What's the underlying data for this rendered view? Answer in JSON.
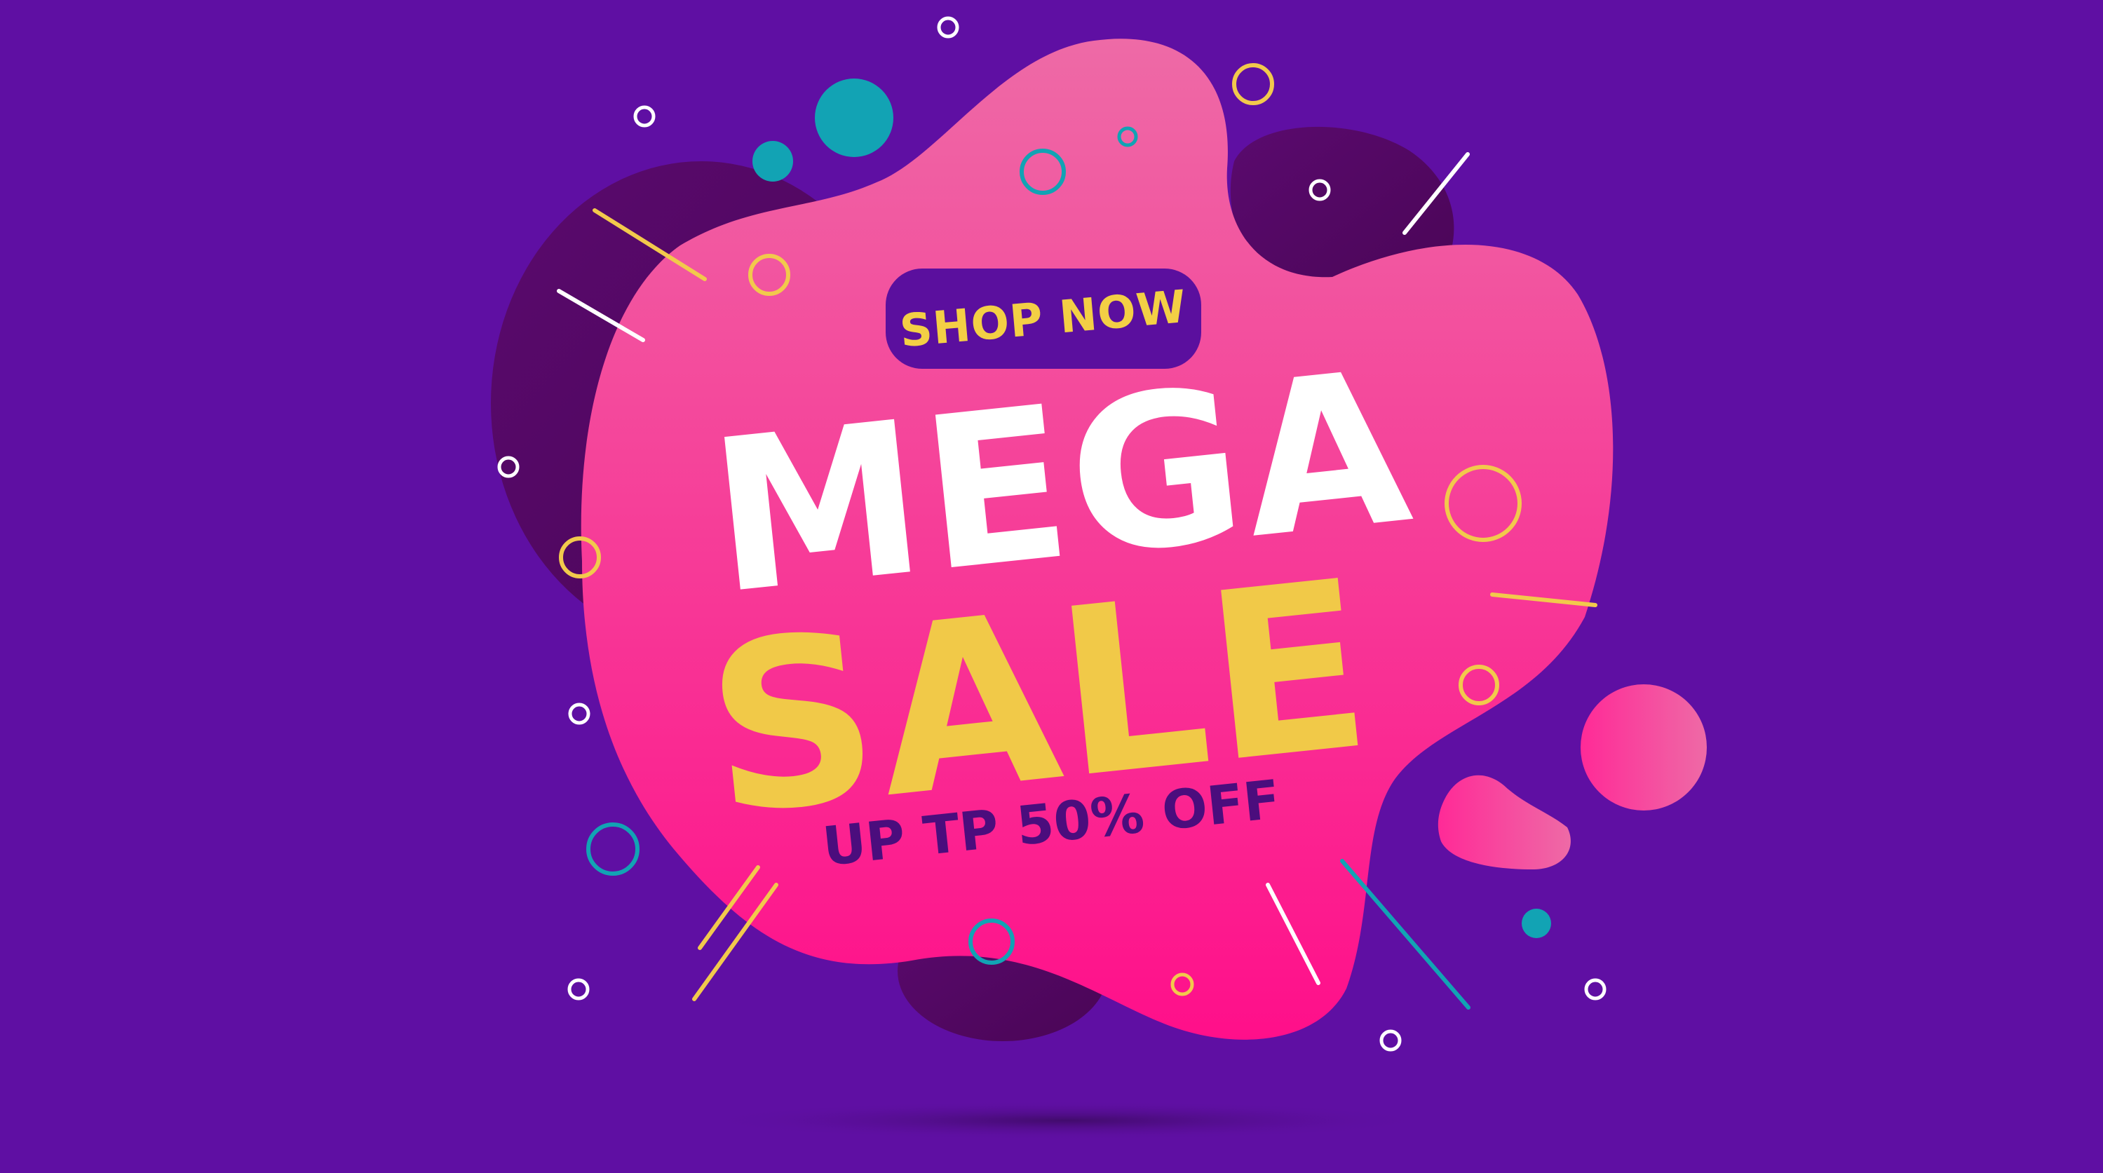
{
  "banner": {
    "shop_now_label": "SHOP NOW",
    "headline_top": "MEGA",
    "headline_bottom": "SALE",
    "offer_text": "UP TP 50% OFF"
  },
  "colors": {
    "background": "#5f0fa3",
    "blob_pink_top": "#ee6aa6",
    "blob_pink_bottom": "#ff0f8a",
    "shadow_purple": "#51085f",
    "yellow_accent": "#f2c94c",
    "teal_accent": "#12a3b4",
    "white_accent": "#ffffff",
    "pill_purple": "#5b0f9e"
  }
}
